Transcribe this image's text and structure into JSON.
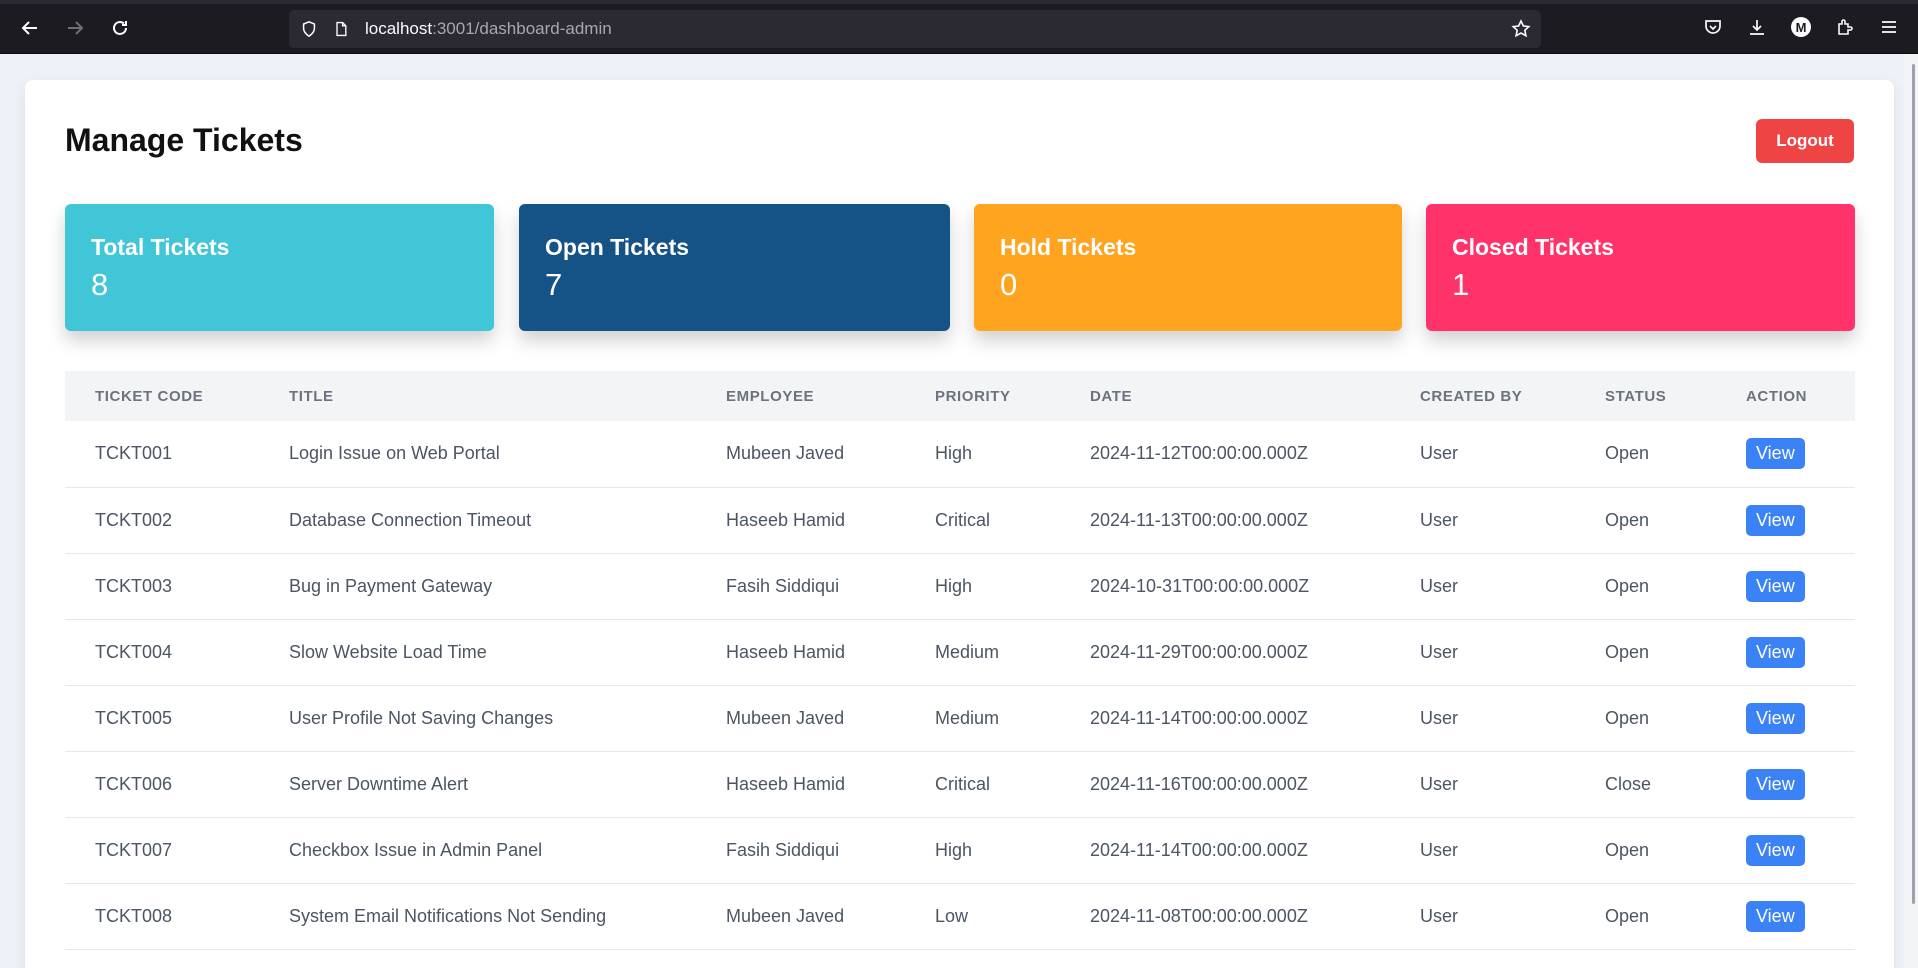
{
  "browser": {
    "url_host": "localhost",
    "url_rest": ":3001/dashboard-admin",
    "profile_initial": "M"
  },
  "page": {
    "title": "Manage Tickets",
    "logout_label": "Logout"
  },
  "stats": [
    {
      "label": "Total Tickets",
      "value": "8",
      "color": "#40c6d6"
    },
    {
      "label": "Open Tickets",
      "value": "7",
      "color": "#155286"
    },
    {
      "label": "Hold Tickets",
      "value": "0",
      "color": "#ffa41f"
    },
    {
      "label": "Closed Tickets",
      "value": "1",
      "color": "#ff336a"
    }
  ],
  "table": {
    "headers": [
      "TICKET CODE",
      "TITLE",
      "EMPLOYEE",
      "PRIORITY",
      "DATE",
      "CREATED BY",
      "STATUS",
      "ACTION"
    ],
    "action_label": "View",
    "rows": [
      {
        "code": "TCKT001",
        "title": "Login Issue on Web Portal",
        "employee": "Mubeen Javed",
        "priority": "High",
        "date": "2024-11-12T00:00:00.000Z",
        "created_by": "User",
        "status": "Open"
      },
      {
        "code": "TCKT002",
        "title": "Database Connection Timeout",
        "employee": "Haseeb Hamid",
        "priority": "Critical",
        "date": "2024-11-13T00:00:00.000Z",
        "created_by": "User",
        "status": "Open"
      },
      {
        "code": "TCKT003",
        "title": "Bug in Payment Gateway",
        "employee": "Fasih Siddiqui",
        "priority": "High",
        "date": "2024-10-31T00:00:00.000Z",
        "created_by": "User",
        "status": "Open"
      },
      {
        "code": "TCKT004",
        "title": "Slow Website Load Time",
        "employee": "Haseeb Hamid",
        "priority": "Medium",
        "date": "2024-11-29T00:00:00.000Z",
        "created_by": "User",
        "status": "Open"
      },
      {
        "code": "TCKT005",
        "title": "User Profile Not Saving Changes",
        "employee": "Mubeen Javed",
        "priority": "Medium",
        "date": "2024-11-14T00:00:00.000Z",
        "created_by": "User",
        "status": "Open"
      },
      {
        "code": "TCKT006",
        "title": "Server Downtime Alert",
        "employee": "Haseeb Hamid",
        "priority": "Critical",
        "date": "2024-11-16T00:00:00.000Z",
        "created_by": "User",
        "status": "Close"
      },
      {
        "code": "TCKT007",
        "title": "Checkbox Issue in Admin Panel",
        "employee": "Fasih Siddiqui",
        "priority": "High",
        "date": "2024-11-14T00:00:00.000Z",
        "created_by": "User",
        "status": "Open"
      },
      {
        "code": "TCKT008",
        "title": "System Email Notifications Not Sending",
        "employee": "Mubeen Javed",
        "priority": "Low",
        "date": "2024-11-08T00:00:00.000Z",
        "created_by": "User",
        "status": "Open"
      }
    ]
  }
}
